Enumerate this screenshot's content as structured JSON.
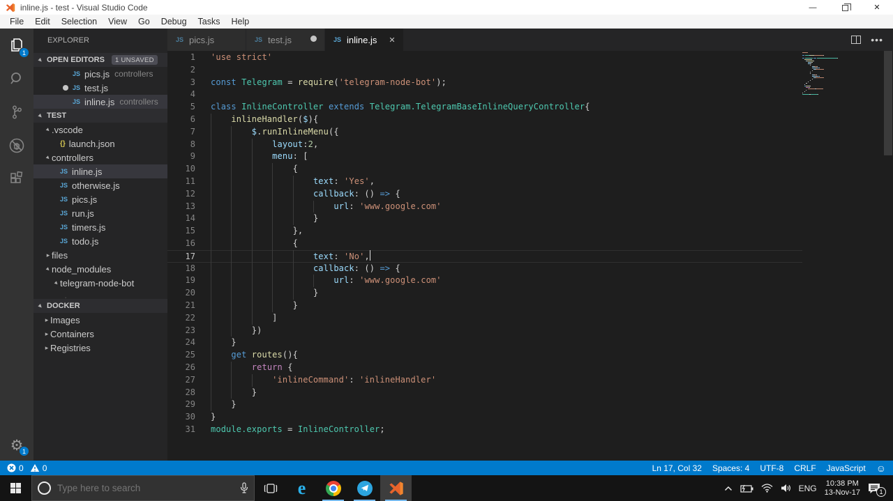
{
  "window": {
    "title": "inline.js - test - Visual Studio Code"
  },
  "menu_bar": {
    "items": [
      "File",
      "Edit",
      "Selection",
      "View",
      "Go",
      "Debug",
      "Tasks",
      "Help"
    ]
  },
  "activity_bar": {
    "explorer_badge": "1",
    "settings_badge": "1"
  },
  "icons": {
    "js_badge": "JS",
    "json_badge": "{}"
  },
  "colors": {
    "accent": "#007acc",
    "vscode_logo": "#e8632b",
    "editor_bg": "#1e1e1e",
    "token_palette": {
      "k": "#569cd6",
      "c": "#c586c0",
      "s": "#ce9178",
      "f": "#dcdcaa",
      "t": "#4ec9b0",
      "v": "#9cdcfe",
      "n": "#b5cea8",
      "p": "#d4d4d4"
    }
  },
  "sidebar": {
    "title": "EXPLORER",
    "open_editors": {
      "label": "OPEN EDITORS",
      "badge": "1 UNSAVED",
      "items": [
        {
          "name": "pics.js",
          "detail": "controllers",
          "modified": false,
          "selected": false
        },
        {
          "name": "test.js",
          "detail": "",
          "modified": true,
          "selected": false
        },
        {
          "name": "inline.js",
          "detail": "controllers",
          "modified": false,
          "selected": true
        }
      ]
    },
    "tree_label": "TEST",
    "tree": [
      {
        "label": ".vscode",
        "type": "folder",
        "state": "expanded",
        "indent": 0,
        "selected": false
      },
      {
        "label": "launch.json",
        "type": "json",
        "state": "",
        "indent": 1,
        "selected": false
      },
      {
        "label": "controllers",
        "type": "folder",
        "state": "expanded",
        "indent": 0,
        "selected": false
      },
      {
        "label": "inline.js",
        "type": "js",
        "state": "",
        "indent": 1,
        "selected": true
      },
      {
        "label": "otherwise.js",
        "type": "js",
        "state": "",
        "indent": 1,
        "selected": false
      },
      {
        "label": "pics.js",
        "type": "js",
        "state": "",
        "indent": 1,
        "selected": false
      },
      {
        "label": "run.js",
        "type": "js",
        "state": "",
        "indent": 1,
        "selected": false
      },
      {
        "label": "timers.js",
        "type": "js",
        "state": "",
        "indent": 1,
        "selected": false
      },
      {
        "label": "todo.js",
        "type": "js",
        "state": "",
        "indent": 1,
        "selected": false
      },
      {
        "label": "files",
        "type": "folder",
        "state": "collapsed",
        "indent": 0,
        "selected": false
      },
      {
        "label": "node_modules",
        "type": "folder",
        "state": "expanded",
        "indent": 0,
        "selected": false
      },
      {
        "label": "telegram-node-bot",
        "type": "folder",
        "state": "expanded",
        "indent": 1,
        "selected": false
      }
    ],
    "docker": {
      "label": "DOCKER",
      "items": [
        {
          "label": "Images",
          "type": "folder",
          "state": "collapsed"
        },
        {
          "label": "Containers",
          "type": "folder",
          "state": "collapsed"
        },
        {
          "label": "Registries",
          "type": "folder",
          "state": "collapsed"
        }
      ]
    }
  },
  "tab_bar": {
    "tabs": [
      {
        "label": "pics.js",
        "active": false,
        "modified": false
      },
      {
        "label": "test.js",
        "active": false,
        "modified": true
      },
      {
        "label": "inline.js",
        "active": true,
        "modified": false
      }
    ],
    "close_glyph": "✕"
  },
  "editor": {
    "current_line": 17,
    "lines": [
      {
        "n": 1,
        "i": 0,
        "t": [
          [
            "s",
            "'use strict'"
          ]
        ]
      },
      {
        "n": 2,
        "i": 0,
        "t": []
      },
      {
        "n": 3,
        "i": 0,
        "t": [
          [
            "k",
            "const"
          ],
          [
            "p",
            " "
          ],
          [
            "t",
            "Telegram"
          ],
          [
            "p",
            " = "
          ],
          [
            "f",
            "require"
          ],
          [
            "p",
            "("
          ],
          [
            "s",
            "'telegram-node-bot'"
          ],
          [
            "p",
            ");"
          ]
        ]
      },
      {
        "n": 4,
        "i": 0,
        "t": []
      },
      {
        "n": 5,
        "i": 0,
        "t": [
          [
            "k",
            "class"
          ],
          [
            "p",
            " "
          ],
          [
            "t",
            "InlineController"
          ],
          [
            "p",
            " "
          ],
          [
            "k",
            "extends"
          ],
          [
            "p",
            " "
          ],
          [
            "t",
            "Telegram.TelegramBaseInlineQueryController"
          ],
          [
            "p",
            "{"
          ]
        ]
      },
      {
        "n": 6,
        "i": 1,
        "t": [
          [
            "f",
            "inlineHandler"
          ],
          [
            "p",
            "("
          ],
          [
            "v",
            "$"
          ],
          [
            "p",
            "){"
          ]
        ]
      },
      {
        "n": 7,
        "i": 2,
        "t": [
          [
            "v",
            "$"
          ],
          [
            "p",
            "."
          ],
          [
            "f",
            "runInlineMenu"
          ],
          [
            "p",
            "({"
          ]
        ]
      },
      {
        "n": 8,
        "i": 3,
        "t": [
          [
            "v",
            "layout"
          ],
          [
            "p",
            ":"
          ],
          [
            "n",
            "2"
          ],
          [
            "p",
            ","
          ]
        ]
      },
      {
        "n": 9,
        "i": 3,
        "t": [
          [
            "v",
            "menu"
          ],
          [
            "p",
            ": ["
          ]
        ]
      },
      {
        "n": 10,
        "i": 4,
        "t": [
          [
            "p",
            "{"
          ]
        ]
      },
      {
        "n": 11,
        "i": 5,
        "t": [
          [
            "v",
            "text"
          ],
          [
            "p",
            ": "
          ],
          [
            "s",
            "'Yes'"
          ],
          [
            "p",
            ","
          ]
        ]
      },
      {
        "n": 12,
        "i": 5,
        "t": [
          [
            "v",
            "callback"
          ],
          [
            "p",
            ": () "
          ],
          [
            "k",
            "=>"
          ],
          [
            "p",
            " {"
          ]
        ]
      },
      {
        "n": 13,
        "i": 6,
        "t": [
          [
            "v",
            "url"
          ],
          [
            "p",
            ": "
          ],
          [
            "s",
            "'www.google.com'"
          ]
        ]
      },
      {
        "n": 14,
        "i": 5,
        "t": [
          [
            "p",
            "}"
          ]
        ]
      },
      {
        "n": 15,
        "i": 4,
        "t": [
          [
            "p",
            "},"
          ]
        ]
      },
      {
        "n": 16,
        "i": 4,
        "t": [
          [
            "p",
            "{"
          ]
        ]
      },
      {
        "n": 17,
        "i": 5,
        "t": [
          [
            "v",
            "text"
          ],
          [
            "p",
            ": "
          ],
          [
            "s",
            "'No'"
          ],
          [
            "p",
            ","
          ]
        ]
      },
      {
        "n": 18,
        "i": 5,
        "t": [
          [
            "v",
            "callback"
          ],
          [
            "p",
            ": () "
          ],
          [
            "k",
            "=>"
          ],
          [
            "p",
            " {"
          ]
        ]
      },
      {
        "n": 19,
        "i": 6,
        "t": [
          [
            "v",
            "url"
          ],
          [
            "p",
            ": "
          ],
          [
            "s",
            "'www.google.com'"
          ]
        ]
      },
      {
        "n": 20,
        "i": 5,
        "t": [
          [
            "p",
            "}"
          ]
        ]
      },
      {
        "n": 21,
        "i": 4,
        "t": [
          [
            "p",
            "}"
          ]
        ]
      },
      {
        "n": 22,
        "i": 3,
        "t": [
          [
            "p",
            "]"
          ]
        ]
      },
      {
        "n": 23,
        "i": 2,
        "t": [
          [
            "p",
            "})"
          ]
        ]
      },
      {
        "n": 24,
        "i": 1,
        "t": [
          [
            "p",
            "}"
          ]
        ]
      },
      {
        "n": 25,
        "i": 1,
        "t": [
          [
            "k",
            "get"
          ],
          [
            "p",
            " "
          ],
          [
            "f",
            "routes"
          ],
          [
            "p",
            "(){"
          ]
        ]
      },
      {
        "n": 26,
        "i": 2,
        "t": [
          [
            "c",
            "return"
          ],
          [
            "p",
            " {"
          ]
        ]
      },
      {
        "n": 27,
        "i": 3,
        "t": [
          [
            "s",
            "'inlineCommand'"
          ],
          [
            "p",
            ": "
          ],
          [
            "s",
            "'inlineHandler'"
          ]
        ]
      },
      {
        "n": 28,
        "i": 2,
        "t": [
          [
            "p",
            "}"
          ]
        ]
      },
      {
        "n": 29,
        "i": 1,
        "t": [
          [
            "p",
            "}"
          ]
        ]
      },
      {
        "n": 30,
        "i": 0,
        "t": [
          [
            "p",
            "}"
          ]
        ]
      },
      {
        "n": 31,
        "i": 0,
        "t": [
          [
            "t",
            "module.exports"
          ],
          [
            "p",
            " = "
          ],
          [
            "t",
            "InlineController"
          ],
          [
            "p",
            ";"
          ]
        ]
      }
    ]
  },
  "status_bar": {
    "errors": "0",
    "warnings": "0",
    "right_items": [
      {
        "name": "cursor-position",
        "label": "Ln 17, Col 32"
      },
      {
        "name": "indentation",
        "label": "Spaces: 4"
      },
      {
        "name": "encoding",
        "label": "UTF-8"
      },
      {
        "name": "eol",
        "label": "CRLF"
      },
      {
        "name": "language-mode",
        "label": "JavaScript"
      }
    ],
    "feedback_glyph": "☺"
  },
  "taskbar": {
    "search_placeholder": "Type here to search",
    "language": "ENG",
    "time": "10:38 PM",
    "date": "13-Nov-17",
    "notification_count": "1"
  }
}
